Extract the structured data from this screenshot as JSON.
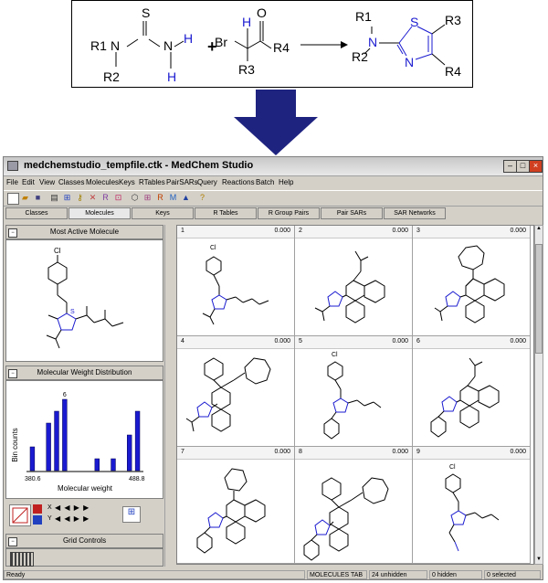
{
  "reaction": {
    "thiourea": {
      "s": "S",
      "r1": "R1",
      "n1": "N",
      "h": "H",
      "n2": "N",
      "h2": "H",
      "r2": "R2"
    },
    "plus": "+",
    "bromoketone": {
      "br": "Br",
      "h": "H",
      "o": "O",
      "r3": "R3",
      "r4": "R4"
    },
    "product": {
      "r1": "R1",
      "n": "N",
      "s": "S",
      "r3": "R3",
      "r2": "R2",
      "n_ring": "N",
      "r4": "R4"
    }
  },
  "window": {
    "title": "medchemstudio_tempfile.ctk - MedChem Studio",
    "menus": [
      "File",
      "Edit",
      "View",
      "Classes",
      "Molecules",
      "Keys",
      "RTables",
      "PairSARs",
      "Query",
      "Reactions",
      "Batch",
      "Help"
    ],
    "tabs": [
      "Classes",
      "Molecules",
      "Keys",
      "R Tables",
      "R Group Pairs",
      "Pair SARs",
      "SAR Networks"
    ],
    "active_tab": "Molecules"
  },
  "left_panel": {
    "most_active_title": "Most Active Molecule",
    "distribution_title": "Molecular Weight Distribution",
    "grid_controls_title": "Grid Controls"
  },
  "chart_data": {
    "type": "bar",
    "ylabel": "Bin counts",
    "xlabel": "Molecular weight",
    "x_min_label": "380.6",
    "x_max_label": "488.8",
    "max_label": "6",
    "values": [
      2,
      0,
      4,
      5,
      6,
      0,
      0,
      0,
      1,
      0,
      1,
      0,
      3,
      5
    ],
    "ylim": [
      0,
      6
    ],
    "color": "#1a1ad0"
  },
  "grid": {
    "cells": [
      {
        "index": "1",
        "value": "0.000"
      },
      {
        "index": "2",
        "value": "0.000"
      },
      {
        "index": "3",
        "value": "0.000"
      },
      {
        "index": "4",
        "value": "0.000"
      },
      {
        "index": "5",
        "value": "0.000"
      },
      {
        "index": "6",
        "value": "0.000"
      },
      {
        "index": "7",
        "value": "0.000"
      },
      {
        "index": "8",
        "value": "0.000"
      },
      {
        "index": "9",
        "value": "0.000"
      }
    ]
  },
  "status": {
    "ready": "Ready",
    "tab": "MOLECULES TAB",
    "unhidden": "24 unhidden",
    "hidden": "0 hidden",
    "selected": "0 selected"
  },
  "molecule_labels": {
    "cl": "Cl",
    "n": "N",
    "s": "S",
    "o": "O"
  }
}
